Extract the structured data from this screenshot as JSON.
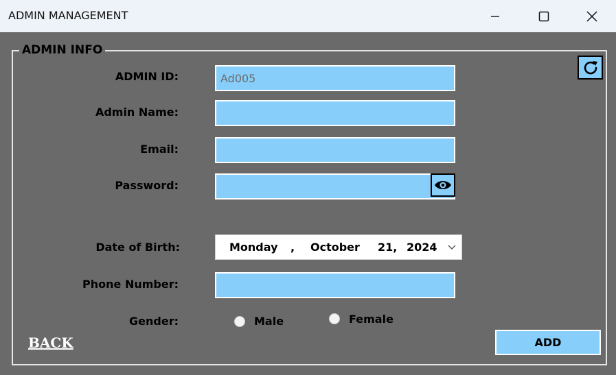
{
  "window": {
    "title": "ADMIN MANAGEMENT"
  },
  "titlebar": {
    "minimize_icon": "minimize-icon",
    "maximize_icon": "maximize-icon",
    "close_icon": "close-icon"
  },
  "group": {
    "legend": "ADMIN INFO"
  },
  "form": {
    "admin_id_label": "ADMIN ID:",
    "admin_id_value": "Ad005",
    "admin_name_label": "Admin Name:",
    "admin_name_value": "",
    "email_label": "Email:",
    "email_value": "",
    "password_label": "Password:",
    "password_value": "",
    "dob_label": "Date of Birth:",
    "dob": {
      "day_name": "Monday",
      "sep": ",",
      "month": "October",
      "day": "21,",
      "year": "2024"
    },
    "phone_label": "Phone Number:",
    "phone_value": "",
    "gender_label": "Gender:",
    "gender_options": [
      "Male",
      "Female"
    ]
  },
  "actions": {
    "back_label": "BACK",
    "add_label": "ADD"
  },
  "colors": {
    "field_bg": "#87cefa",
    "client_bg": "#6a6a6a",
    "titlebar_bg": "#eef3f9"
  },
  "icons": {
    "eye": "eye-icon",
    "refresh": "refresh-icon"
  }
}
